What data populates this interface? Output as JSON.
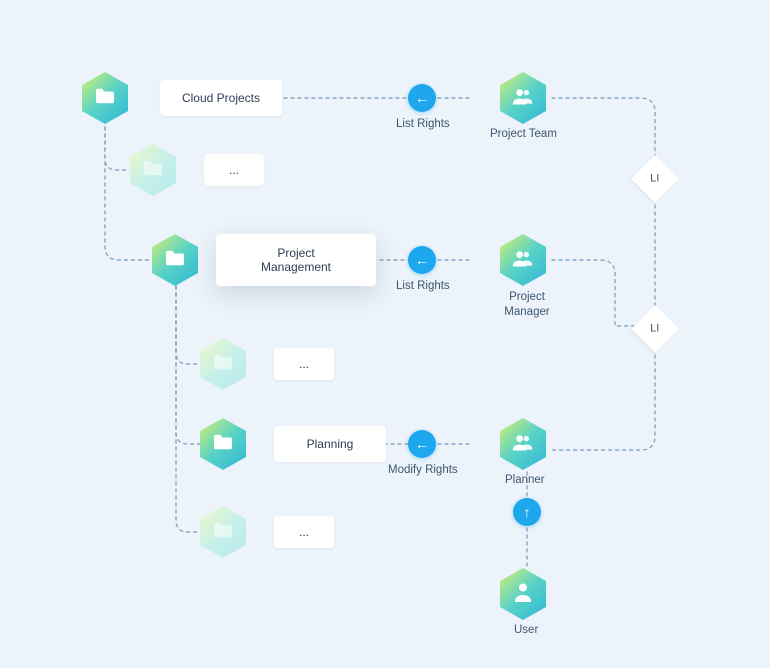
{
  "level0": {
    "folder": "Cloud Projects",
    "rights": "List Rights",
    "role": "Project Team",
    "ellipsis": "..."
  },
  "level1": {
    "folder": "Project\nManagement",
    "rights": "List Rights",
    "role": "Project\nManager",
    "ellipsis": "..."
  },
  "level2": {
    "folder": "Planning",
    "rights": "Modify Rights",
    "role": "Planner",
    "ellipsis": "..."
  },
  "user": "User",
  "decision": {
    "label1": "LI",
    "label2": "LI"
  },
  "arrows": {
    "left": "←",
    "up": "↑"
  }
}
